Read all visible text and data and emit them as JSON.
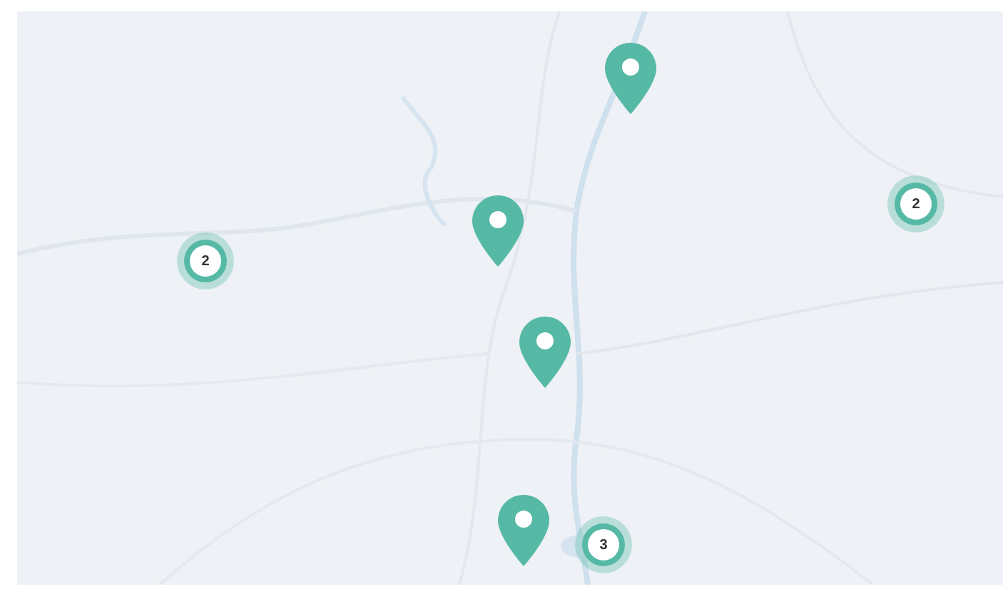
{
  "markers": [
    {
      "kind": "pin"
    },
    {
      "kind": "pin"
    },
    {
      "kind": "pin"
    },
    {
      "kind": "pin"
    },
    {
      "kind": "cluster",
      "count": "2"
    },
    {
      "kind": "cluster",
      "count": "2"
    },
    {
      "kind": "cluster",
      "count": "3"
    }
  ]
}
